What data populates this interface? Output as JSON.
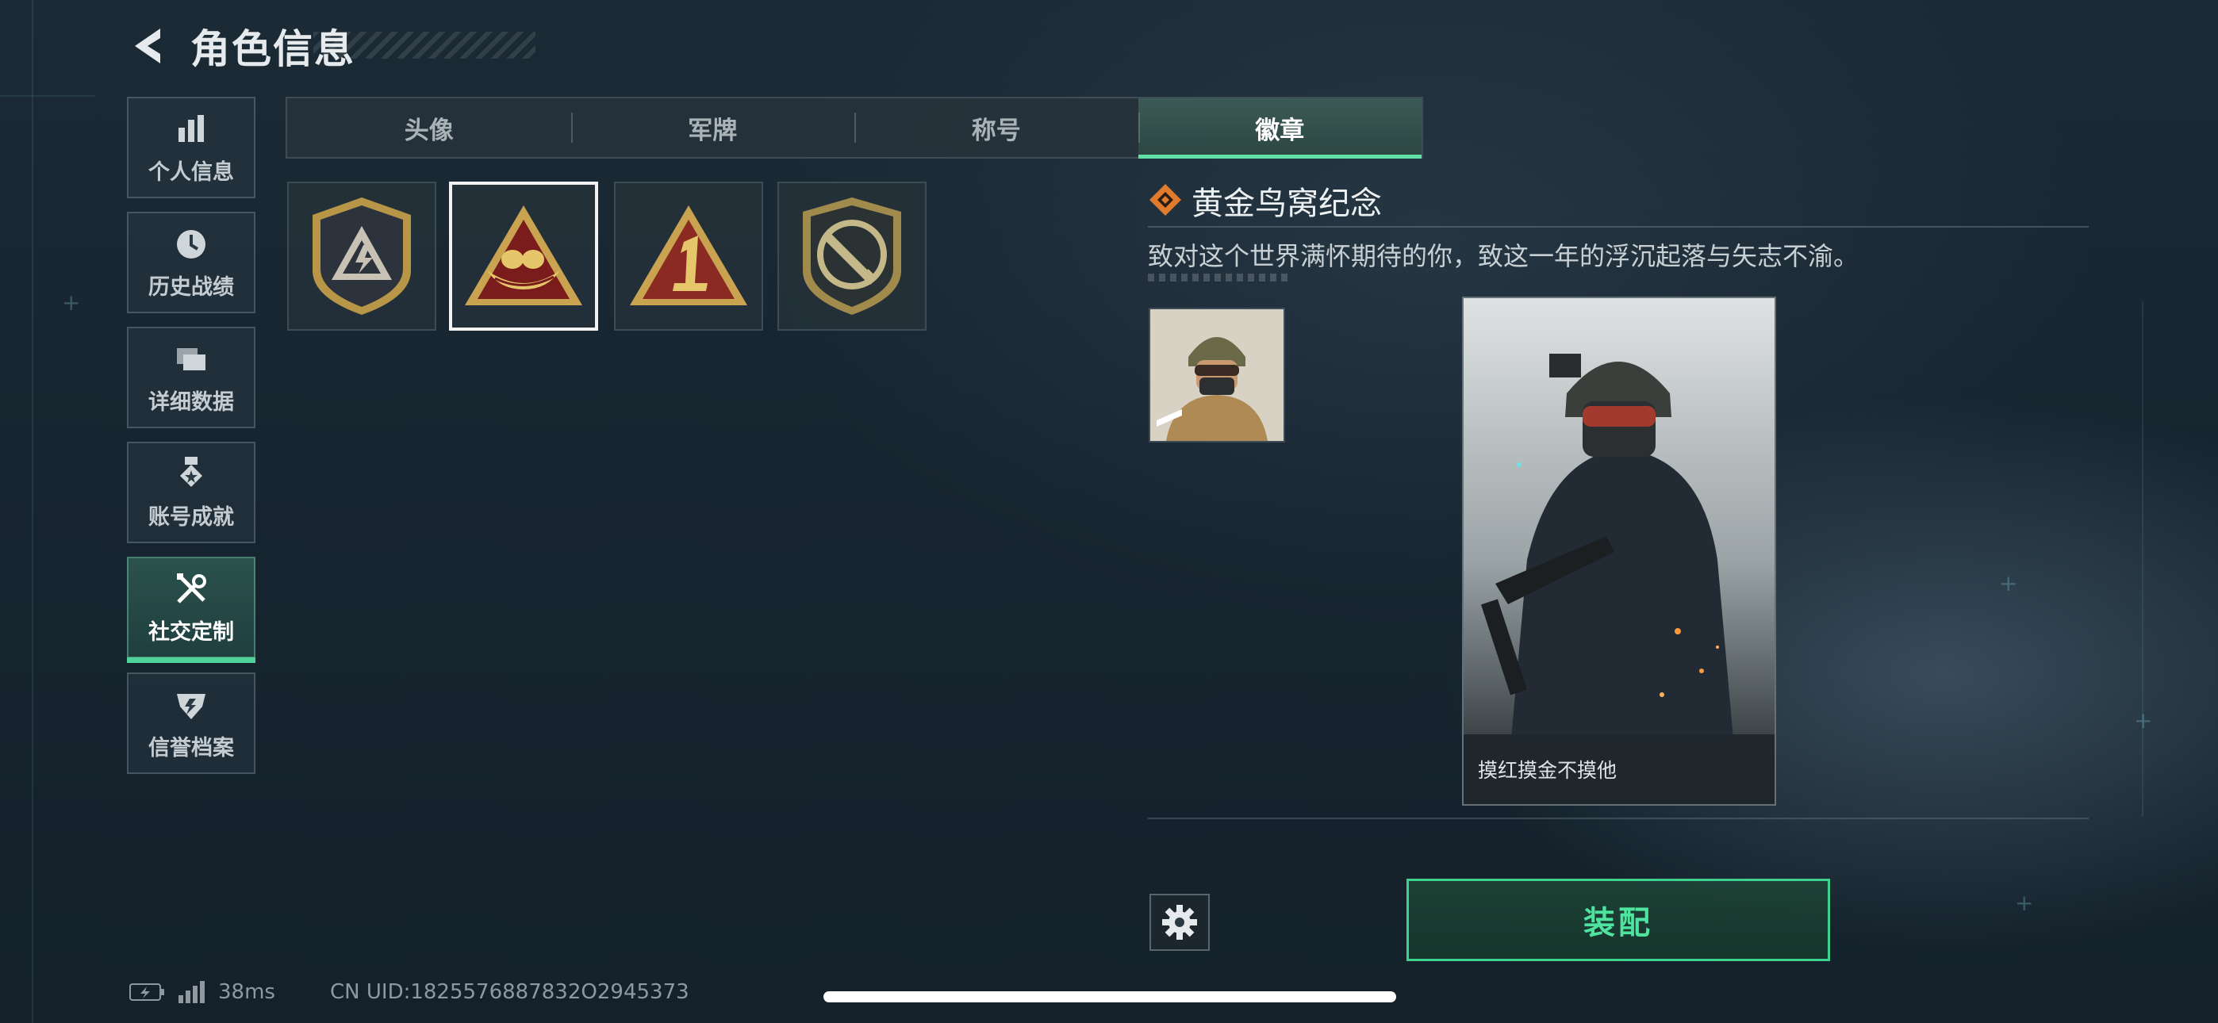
{
  "header": {
    "title": "角色信息"
  },
  "sidebar": {
    "items": [
      {
        "label": "个人信息",
        "icon": "bar-chart-icon"
      },
      {
        "label": "历史战绩",
        "icon": "clock-icon"
      },
      {
        "label": "详细数据",
        "icon": "folder-icon"
      },
      {
        "label": "账号成就",
        "icon": "medal-icon"
      },
      {
        "label": "社交定制",
        "icon": "tools-icon",
        "active": true
      },
      {
        "label": "信誉档案",
        "icon": "shield-icon"
      }
    ]
  },
  "tabs": [
    {
      "label": "头像"
    },
    {
      "label": "军牌"
    },
    {
      "label": "称号"
    },
    {
      "label": "徽章",
      "active": true
    }
  ],
  "badges": [
    {
      "name": "triangle-lightning-badge"
    },
    {
      "name": "golden-nest-badge",
      "selected": true
    },
    {
      "name": "number-one-badge"
    },
    {
      "name": "knife-shield-badge"
    }
  ],
  "detail": {
    "title": "黄金鸟窝纪念",
    "description": "致对这个世界满怀期待的你，致这一年的浮沉起落与矢志不渝。",
    "card_caption": "摸红摸金不摸他"
  },
  "actions": {
    "equip_label": "装配"
  },
  "status_bar": {
    "ping": "38ms",
    "uid": "CN UID:1825576887832O2945373"
  },
  "colors": {
    "accent": "#4fe3a0",
    "background": "#172530"
  }
}
